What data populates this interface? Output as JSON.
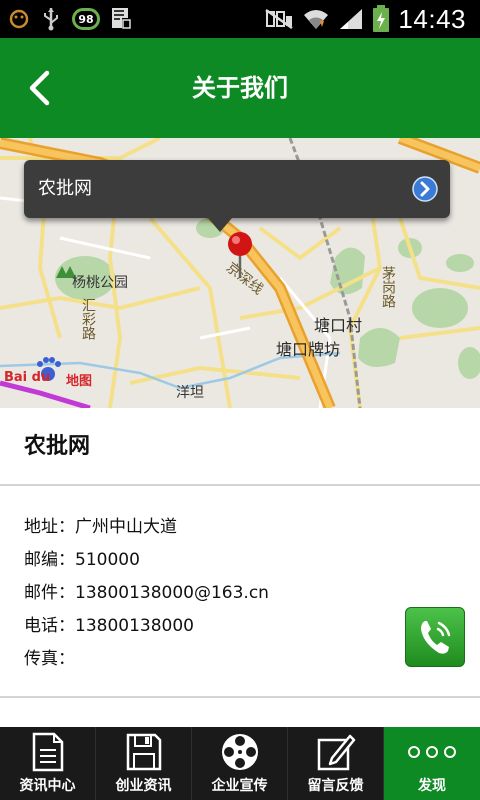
{
  "status_bar": {
    "time": "14:43",
    "badge_value": "98",
    "icons": [
      "face-icon",
      "usb-icon",
      "battery-level-badge",
      "keyboard-icon",
      "no-sim-icon",
      "wifi-icon",
      "signal-icon",
      "battery-charging-icon"
    ]
  },
  "header": {
    "title": "关于我们",
    "back_icon": "chevron-left-icon",
    "color": "#0d8a23"
  },
  "map": {
    "callout_label": "农批网",
    "callout_arrow_icon": "chevron-right-circle-icon",
    "labels": {
      "park": "杨桃公园",
      "road_huicai": "汇彩路",
      "road_jingshen": "京深线",
      "village_tangkou": "塘口村",
      "village_tangkou_paifang": "塘口牌坊",
      "road_maogang": "茅岗路",
      "place_yangtan": "洋坦",
      "baidu_brand": "Bai du",
      "baidu_map": "地图"
    }
  },
  "company": {
    "name": "农批网",
    "address": "地址：广州中山大道",
    "postcode": "邮编：510000",
    "email": "邮件：13800138000@163.cn",
    "phone": "电话：13800138000",
    "fax": "传真："
  },
  "call_button_icon": "phone-icon",
  "tabs": [
    {
      "label": "资讯中心",
      "icon": "document-icon",
      "active": false
    },
    {
      "label": "创业资讯",
      "icon": "save-icon",
      "active": false
    },
    {
      "label": "企业宣传",
      "icon": "film-reel-icon",
      "active": false
    },
    {
      "label": "留言反馈",
      "icon": "edit-icon",
      "active": false
    },
    {
      "label": "发现",
      "icon": "more-dots-icon",
      "active": true
    }
  ]
}
